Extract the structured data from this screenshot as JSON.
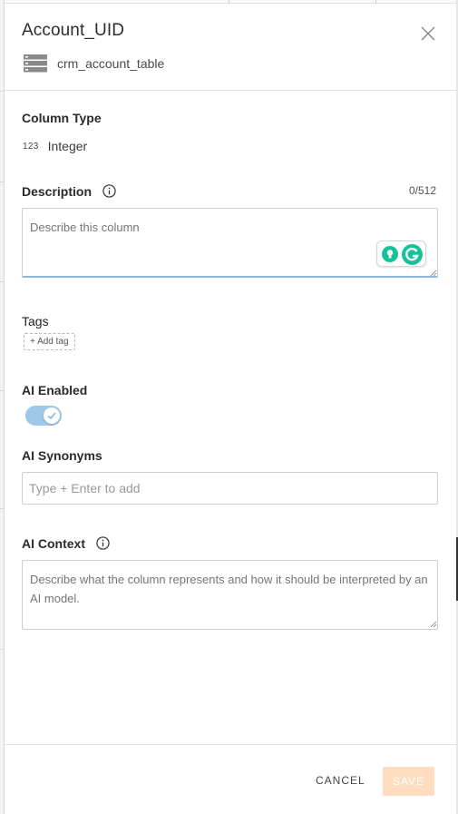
{
  "panel": {
    "title": "Account_UID",
    "table_name": "crm_account_table"
  },
  "column_type": {
    "label": "Column Type",
    "icon_text": "123",
    "value": "Integer"
  },
  "description": {
    "label": "Description",
    "counter": "0/512",
    "placeholder": "Describe this column"
  },
  "tags": {
    "label": "Tags",
    "add_label": "+ Add tag"
  },
  "ai_enabled": {
    "label": "AI Enabled",
    "checked": true,
    "accent": "#9ec7ec"
  },
  "ai_synonyms": {
    "label": "AI Synonyms",
    "placeholder": "Type + Enter to add"
  },
  "ai_context": {
    "label": "AI Context",
    "placeholder": "Describe what the column represents and how it should be interpreted by an AI model."
  },
  "footer": {
    "cancel_label": "CANCEL",
    "save_label": "SAVE",
    "save_color": "#fddcbf"
  }
}
